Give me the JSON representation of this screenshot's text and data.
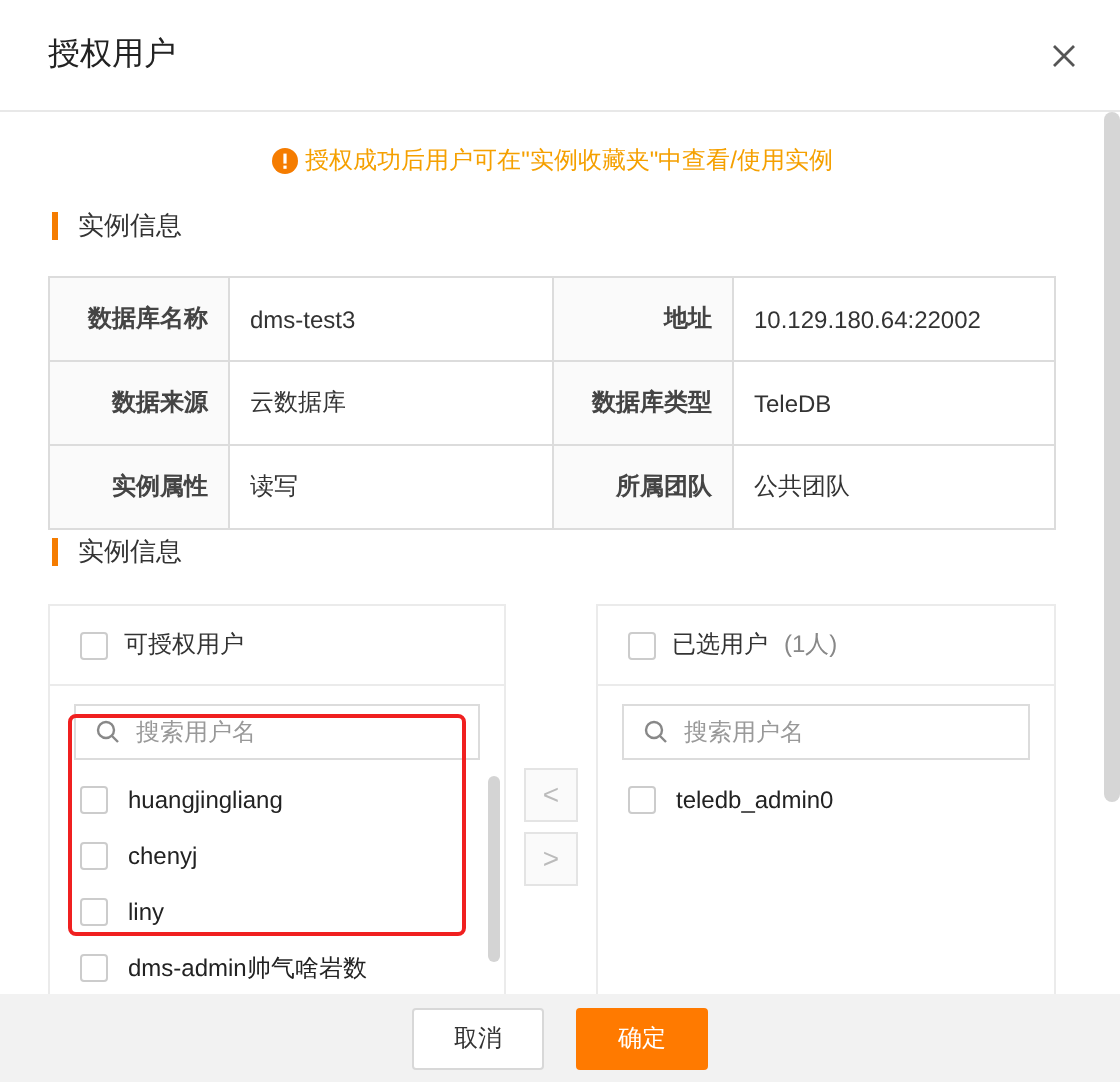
{
  "dialog": {
    "title": "授权用户"
  },
  "notice": {
    "text": "授权成功后用户可在\"实例收藏夹\"中查看/使用实例"
  },
  "section_1": {
    "title": "实例信息"
  },
  "info_table": {
    "rows": [
      [
        {
          "label": "数据库名称",
          "value": "dms-test3"
        },
        {
          "label": "地址",
          "value": "10.129.180.64:22002"
        }
      ],
      [
        {
          "label": "数据来源",
          "value": "云数据库"
        },
        {
          "label": "数据库类型",
          "value": "TeleDB"
        }
      ],
      [
        {
          "label": "实例属性",
          "value": "读写"
        },
        {
          "label": "所属团队",
          "value": "公共团队"
        }
      ]
    ]
  },
  "section_2": {
    "title": "实例信息"
  },
  "transfer": {
    "source": {
      "title": "可授权用户",
      "checked": false,
      "placeholder": "搜索用户名",
      "items": [
        {
          "name": "huangjingliang",
          "checked": false
        },
        {
          "name": "chenyj",
          "checked": false
        },
        {
          "name": "liny",
          "checked": false
        },
        {
          "name": "dms-admin帅气啥岩数",
          "checked": false
        }
      ]
    },
    "buttons": [
      {
        "label": "<",
        "disabled": true
      },
      {
        "label": ">",
        "disabled": true
      }
    ],
    "target": {
      "title": "已选用户",
      "count": "(1人)",
      "checked": false,
      "placeholder": "搜索用户名",
      "items": [
        {
          "name": "teledb_admin0",
          "checked": false
        }
      ]
    }
  },
  "footer": {
    "buttons": [
      {
        "label": "取消",
        "kind": "default"
      },
      {
        "label": "确定",
        "kind": "primary"
      }
    ]
  }
}
